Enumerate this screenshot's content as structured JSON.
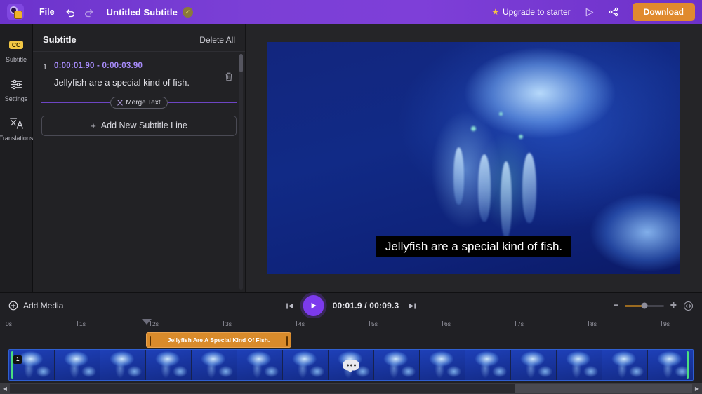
{
  "header": {
    "logo_icon": "app-logo-icon",
    "file_menu": "File",
    "undo_icon": "undo-icon",
    "redo_icon": "redo-icon",
    "doc_title": "Untitled Subtitle",
    "save_badge_icon": "saved-cloud-check-icon",
    "upgrade_label": "Upgrade to starter",
    "star_icon": "star-icon",
    "present_icon": "present-play-icon",
    "share_icon": "share-icon",
    "download_label": "Download",
    "accent_purple": "#7b3fd6",
    "download_orange": "#e08a2e"
  },
  "rail": {
    "items": [
      {
        "label": "Subtitle",
        "icon": "cc-icon",
        "badge_text": "CC",
        "active": true
      },
      {
        "label": "Settings",
        "icon": "sliders-icon",
        "active": false
      },
      {
        "label": "Translations",
        "icon": "translate-icon",
        "active": false
      }
    ]
  },
  "panel": {
    "title": "Subtitle",
    "delete_all": "Delete All",
    "entries": [
      {
        "index": "1",
        "time_range": "0:00:01.90 - 0:00:03.90",
        "text": "Jellyfish are a special kind of fish.",
        "delete_icon": "trash-icon"
      }
    ],
    "merge_label": "Merge Text",
    "merge_icon": "merge-icon",
    "add_line_label": "Add New Subtitle Line",
    "add_icon": "plus-icon",
    "divider_color": "#6d45c4"
  },
  "preview": {
    "caption": "Jellyfish are a special kind of fish.",
    "caption_bg": "#000000",
    "caption_color": "#ffffff"
  },
  "timeline": {
    "add_media_label": "Add Media",
    "add_media_icon": "plus-circle-icon",
    "skip_back_icon": "skip-back-icon",
    "play_icon": "play-icon",
    "skip_forward_icon": "skip-forward-icon",
    "current_time": "00:01.9",
    "separator": "/",
    "total_time": "00:09.3",
    "time_display": "00:01.9 / 00:09.3",
    "zoom_out_icon": "minus-icon",
    "zoom_in_icon": "plus-icon",
    "fit_icon": "fit-to-width-icon",
    "zoom_percent": 50,
    "ruler_ticks": [
      "0s",
      "1s",
      "2s",
      "3s",
      "4s",
      "5s",
      "6s",
      "7s",
      "8s",
      "9s"
    ],
    "playhead_label": "playhead",
    "playhead_seconds": 1.9,
    "clip": {
      "label": "Jellyfish Are A Special Kind Of Fish.",
      "start_seconds": 1.9,
      "end_seconds": 3.9,
      "color": "#d98b2b"
    },
    "filmstrip": {
      "frame_count": 15,
      "badge_text": "1",
      "bubble_icon": "speech-bubble-icon",
      "bubble_frame_index": 7
    },
    "scrollbar": {
      "left_arrow_icon": "arrow-left-icon",
      "right_arrow_icon": "arrow-right-icon",
      "thumb_percent": 74
    }
  }
}
